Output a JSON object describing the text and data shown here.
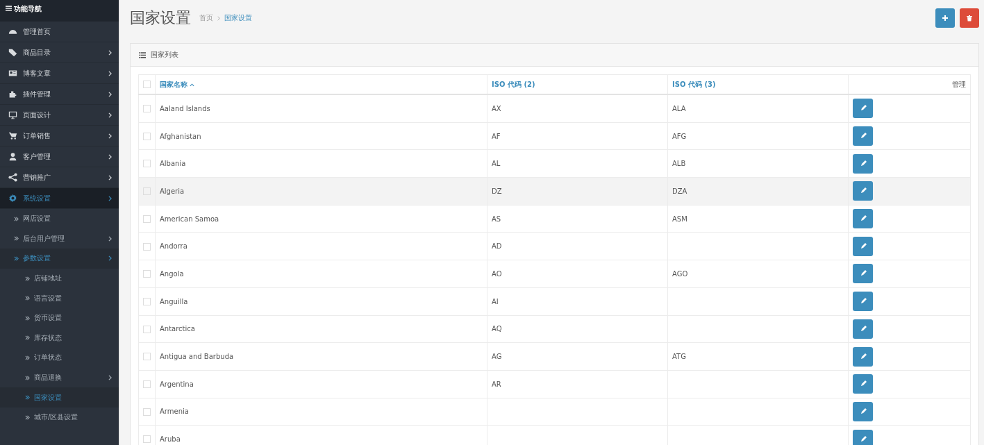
{
  "sidebar": {
    "title": "功能导航",
    "items": [
      {
        "label": "管理首页",
        "has_children": false,
        "selected": false
      },
      {
        "label": "商品目录",
        "has_children": true,
        "selected": false
      },
      {
        "label": "博客文章",
        "has_children": true,
        "selected": false
      },
      {
        "label": "插件管理",
        "has_children": true,
        "selected": false
      },
      {
        "label": "页面设计",
        "has_children": true,
        "selected": false
      },
      {
        "label": "订单销售",
        "has_children": true,
        "selected": false
      },
      {
        "label": "客户管理",
        "has_children": true,
        "selected": false
      },
      {
        "label": "营销推广",
        "has_children": true,
        "selected": false
      },
      {
        "label": "系统设置",
        "has_children": true,
        "selected": true,
        "children": [
          {
            "label": "网店设置",
            "has_children": false,
            "selected": false
          },
          {
            "label": "后台用户管理",
            "has_children": true,
            "selected": false
          },
          {
            "label": "参数设置",
            "has_children": true,
            "selected": true,
            "children": [
              {
                "label": "店铺地址",
                "has_children": false,
                "selected": false
              },
              {
                "label": "语言设置",
                "has_children": false,
                "selected": false
              },
              {
                "label": "货币设置",
                "has_children": false,
                "selected": false
              },
              {
                "label": "库存状态",
                "has_children": false,
                "selected": false
              },
              {
                "label": "订单状态",
                "has_children": false,
                "selected": false
              },
              {
                "label": "商品退换",
                "has_children": true,
                "selected": false
              },
              {
                "label": "国家设置",
                "has_children": false,
                "selected": true
              },
              {
                "label": "城市/区县设置",
                "has_children": false,
                "selected": false
              }
            ]
          }
        ]
      }
    ]
  },
  "header": {
    "title": "国家设置",
    "breadcrumb": [
      {
        "label": "首页",
        "selected": false
      },
      {
        "label": "国家设置",
        "selected": true
      }
    ]
  },
  "actions": [
    {
      "kind": "add"
    },
    {
      "kind": "delete"
    }
  ],
  "panel": {
    "title": "国家列表",
    "table": {
      "all_checked": false,
      "columns": [
        {
          "label": "国家名称",
          "sorted": true
        },
        {
          "label": "ISO 代码 (2)",
          "sorted": false
        },
        {
          "label": "ISO 代码 (3)",
          "sorted": false
        },
        {
          "label": "管理",
          "sorted": false
        }
      ],
      "rows": [
        {
          "name": "Aaland Islands",
          "iso2": "AX",
          "iso3": "ALA",
          "hovered": false,
          "checked": false
        },
        {
          "name": "Afghanistan",
          "iso2": "AF",
          "iso3": "AFG",
          "hovered": false,
          "checked": false
        },
        {
          "name": "Albania",
          "iso2": "AL",
          "iso3": "ALB",
          "hovered": false,
          "checked": false
        },
        {
          "name": "Algeria",
          "iso2": "DZ",
          "iso3": "DZA",
          "hovered": true,
          "checked": false
        },
        {
          "name": "American Samoa",
          "iso2": "AS",
          "iso3": "ASM",
          "hovered": false,
          "checked": false
        },
        {
          "name": "Andorra",
          "iso2": "AD",
          "hovered": false,
          "checked": false
        },
        {
          "name": "Angola",
          "iso2": "AO",
          "iso3": "AGO",
          "hovered": false,
          "checked": false
        },
        {
          "name": "Anguilla",
          "iso2": "AI",
          "hovered": false,
          "checked": false
        },
        {
          "name": "Antarctica",
          "iso2": "AQ",
          "hovered": false,
          "checked": false
        },
        {
          "name": "Antigua and Barbuda",
          "iso2": "AG",
          "iso3": "ATG",
          "hovered": false,
          "checked": false
        },
        {
          "name": "Argentina",
          "iso2": "AR",
          "hovered": false,
          "checked": false
        },
        {
          "name": "Armenia",
          "hovered": false,
          "checked": false
        },
        {
          "name": "Aruba",
          "hovered": false,
          "checked": false
        }
      ]
    }
  }
}
